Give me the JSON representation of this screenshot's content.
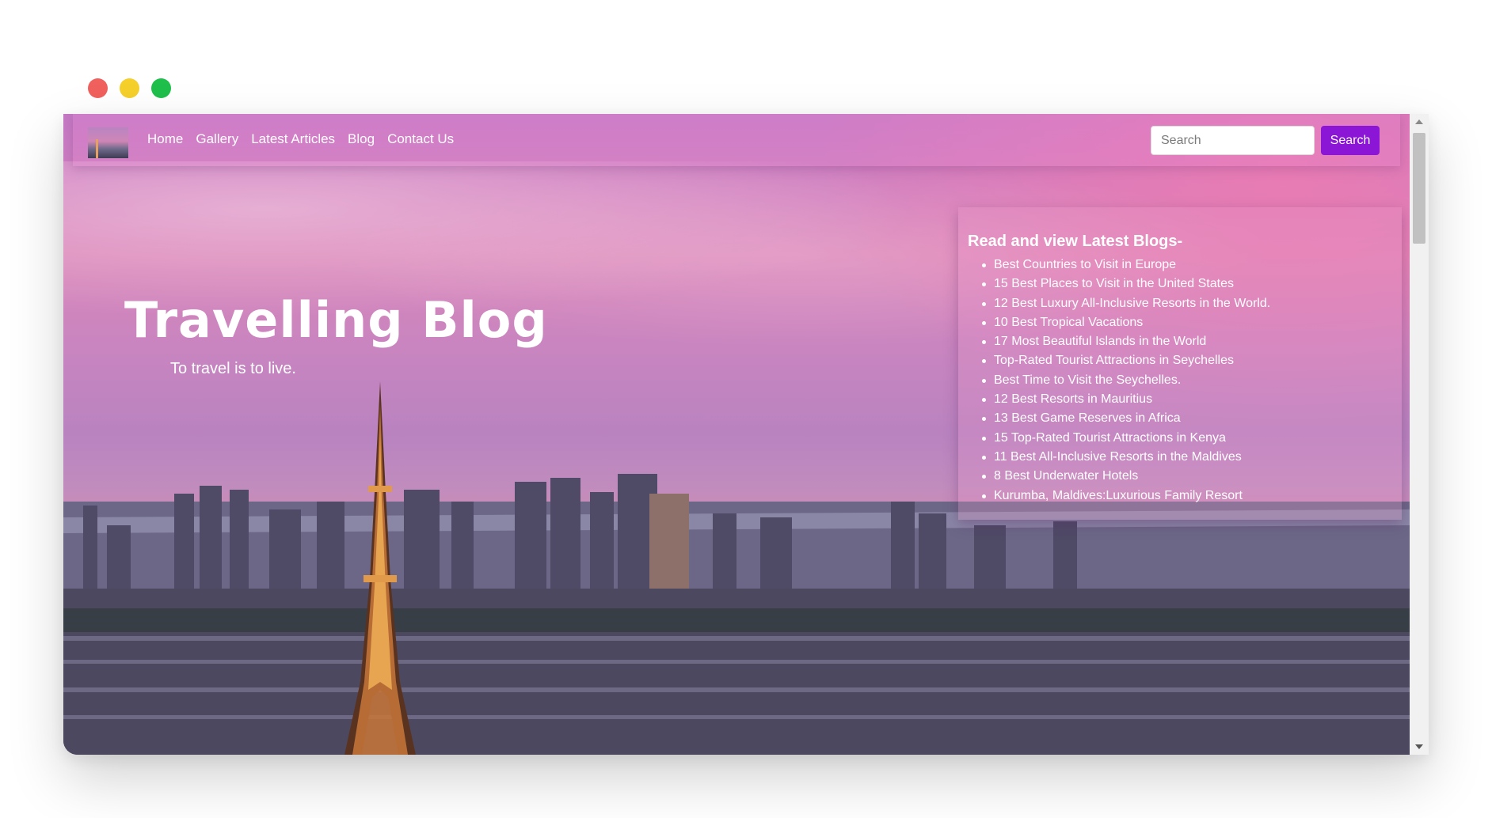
{
  "window_controls": {
    "close_color": "#f0605d",
    "minimize_color": "#f5cf2a",
    "maximize_color": "#1fbf4c"
  },
  "navbar": {
    "links": [
      "Home",
      "Gallery",
      "Latest Articles",
      "Blog",
      "Contact Us"
    ],
    "search_placeholder": "Search",
    "search_button": "Search",
    "accent_color": "#8b16d6"
  },
  "hero": {
    "title": "Travelling Blog",
    "subtitle": "To travel is to live."
  },
  "blogs": {
    "heading": "Read and view Latest Blogs-",
    "items": [
      "Best Countries to Visit in Europe",
      "15 Best Places to Visit in the United States",
      "12 Best Luxury All-Inclusive Resorts in the World.",
      "10 Best Tropical Vacations",
      "17 Most Beautiful Islands in the World",
      "Top-Rated Tourist Attractions in Seychelles",
      "Best Time to Visit the Seychelles.",
      "12 Best Resorts in Mauritius",
      "13 Best Game Reserves in Africa",
      "15 Top-Rated Tourist Attractions in Kenya",
      "11 Best All-Inclusive Resorts in the Maldives",
      "8 Best Underwater Hotels",
      "Kurumba, Maldives:Luxurious Family Resort"
    ]
  }
}
